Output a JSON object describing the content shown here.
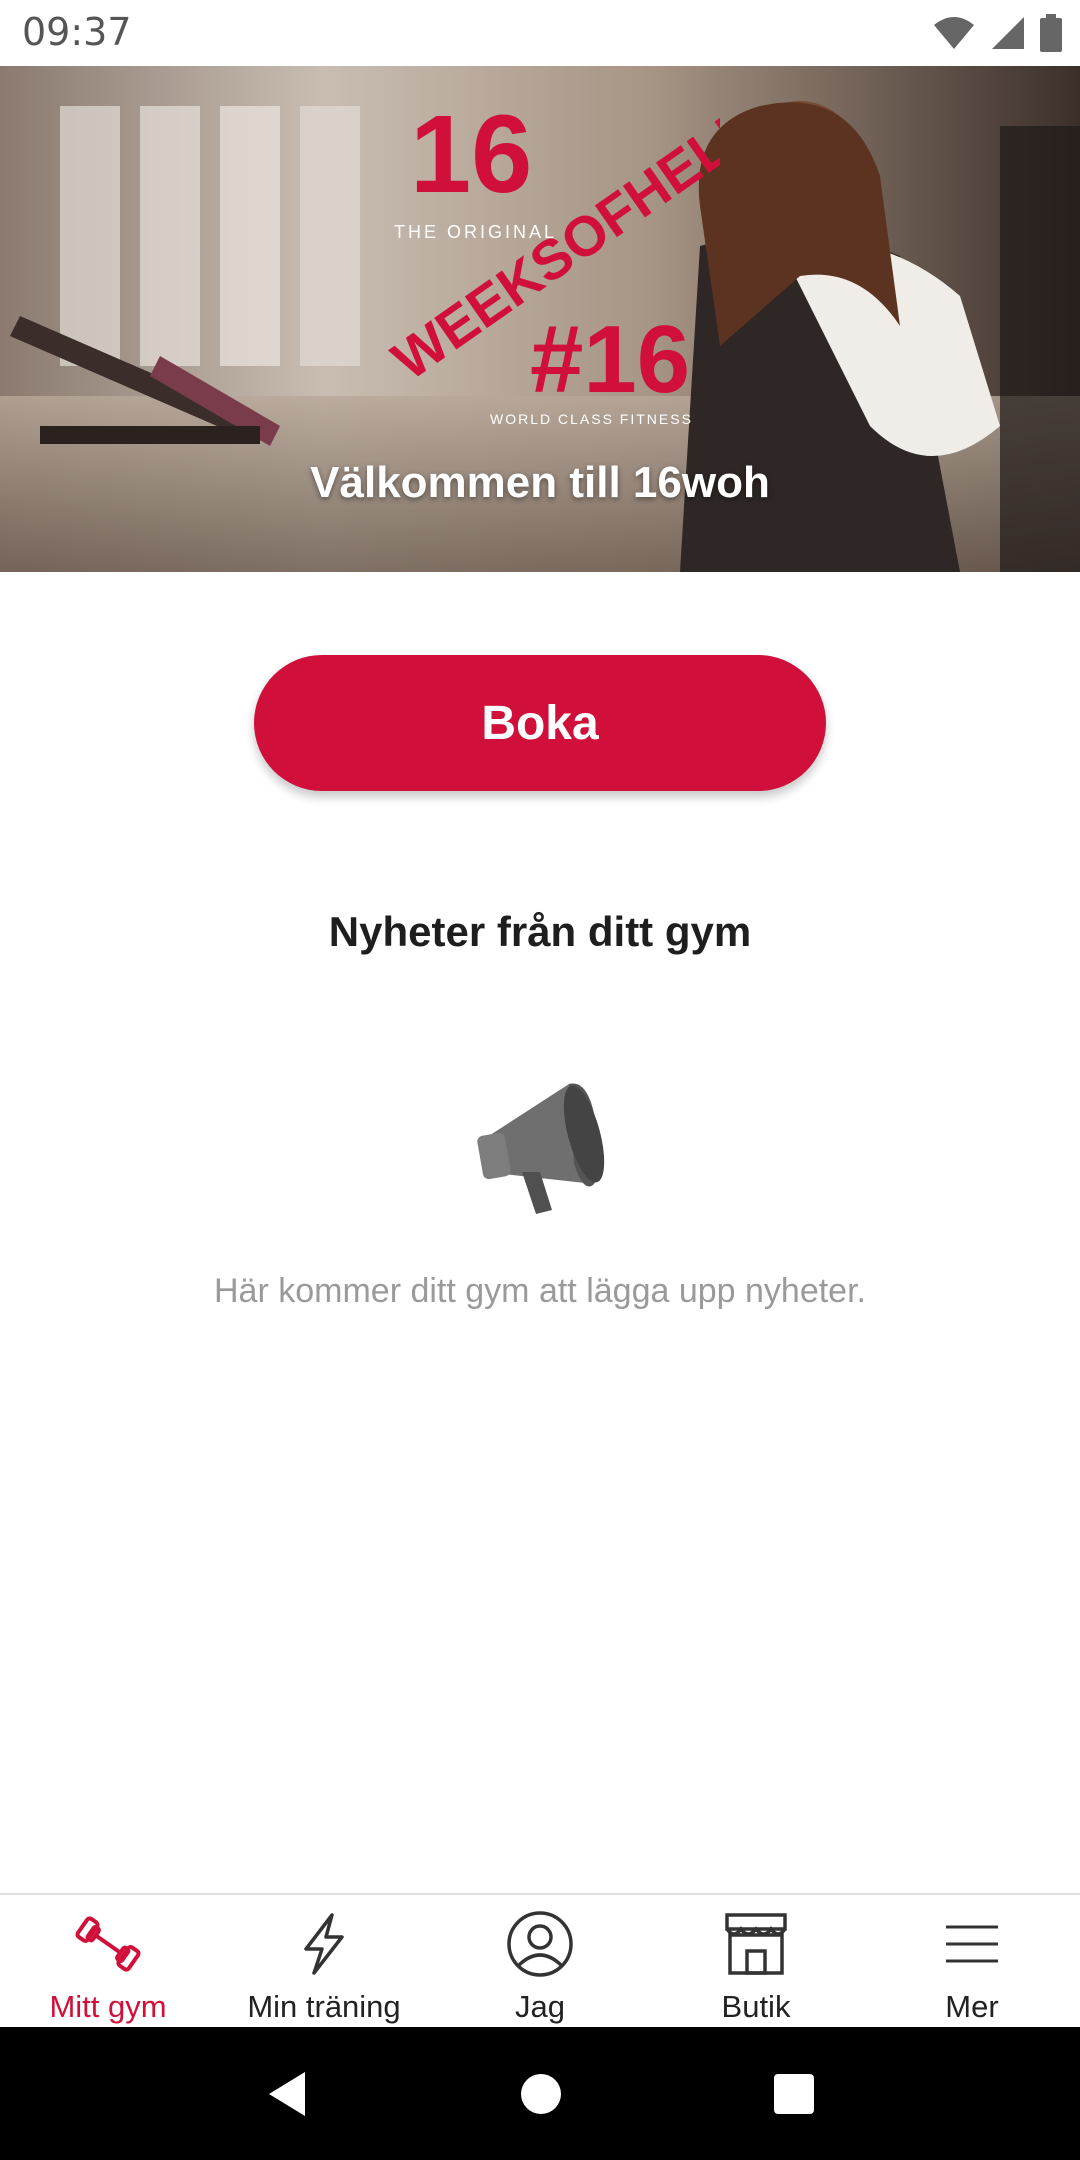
{
  "status_bar": {
    "time": "09:37",
    "icons": [
      "wifi-icon",
      "signal-icon",
      "battery-icon"
    ]
  },
  "hero": {
    "logo_text": {
      "number": "16",
      "original": "THE ORIGINAL",
      "banner": "WEEKSOFHELL",
      "hashtag": "#16",
      "tagline": "WORLD CLASS FITNESS"
    },
    "title": "Välkommen till 16woh"
  },
  "boka_button": {
    "label": "Boka"
  },
  "news": {
    "heading": "Nyheter från ditt gym",
    "icon": "megaphone-icon",
    "empty_text": "Här kommer ditt gym att lägga upp nyheter."
  },
  "bottom_nav": {
    "items": [
      {
        "label": "Mitt gym",
        "icon": "dumbbell-icon",
        "active": true
      },
      {
        "label": "Min träning",
        "icon": "lightning-icon",
        "active": false
      },
      {
        "label": "Jag",
        "icon": "profile-icon",
        "active": false
      },
      {
        "label": "Butik",
        "icon": "store-icon",
        "active": false
      },
      {
        "label": "Mer",
        "icon": "menu-icon",
        "active": false
      }
    ]
  },
  "colors": {
    "brand": "#d0103a",
    "text_muted": "#9a9a9a"
  }
}
